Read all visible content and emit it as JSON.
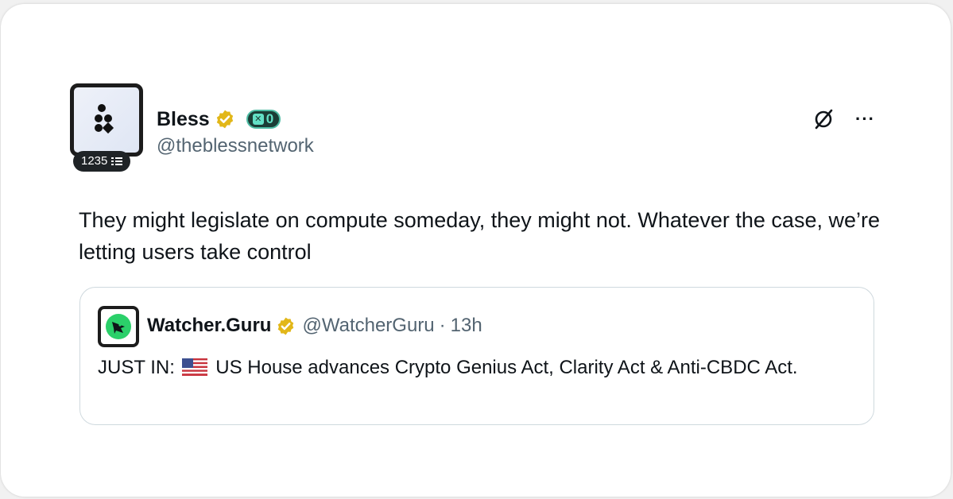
{
  "post": {
    "display_name": "Bless",
    "handle": "@theblessnetwork",
    "badge_count": "1235",
    "x_badge_value": "0",
    "text": "They might legislate on compute someday, they might not. Whatever the case, we’re letting users take control"
  },
  "quoted": {
    "display_name": "Watcher.Guru",
    "handle": "@WatcherGuru",
    "separator": "·",
    "time": "13h",
    "text_prefix": "JUST IN:",
    "text_body": "US House advances Crypto Genius Act, Clarity Act & Anti-CBDC Act."
  },
  "colors": {
    "verified_gold": "#e2b719",
    "text_primary": "#0f1419",
    "text_secondary": "#536471",
    "x_badge_accent": "#63e0c6"
  },
  "icons": {
    "verified": "verified-gold-badge-icon",
    "flag": "us-flag-icon",
    "grok": "grok-slash-icon",
    "more": "more-options-icon"
  }
}
